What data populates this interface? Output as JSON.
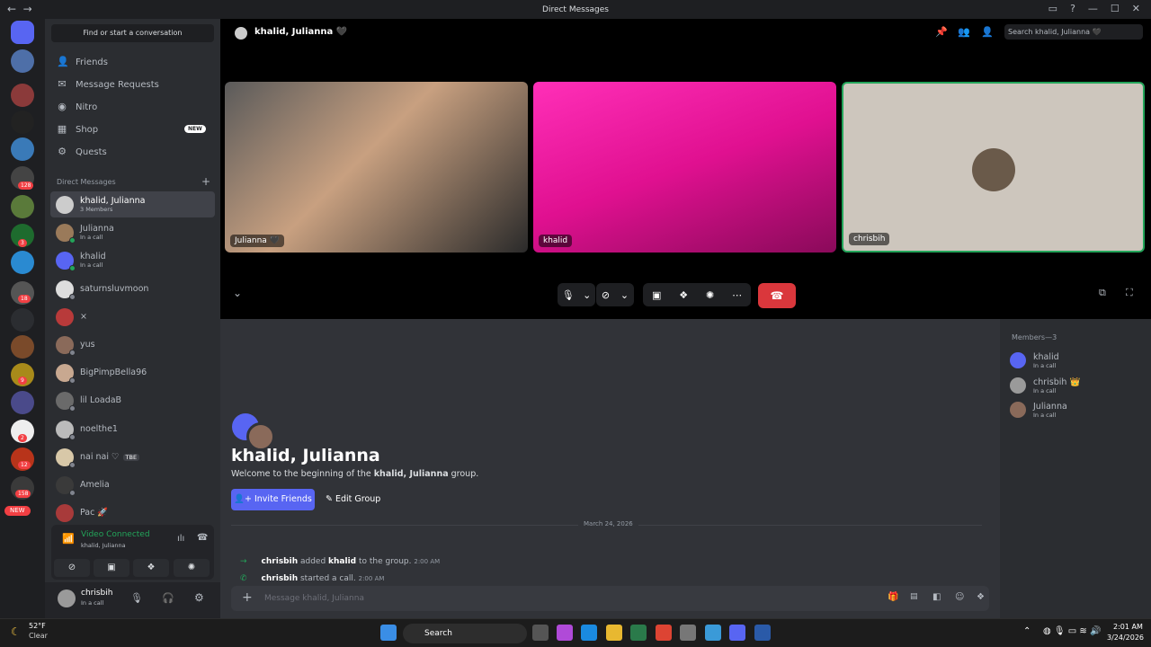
{
  "window": {
    "title": "Direct Messages"
  },
  "sidebar": {
    "find_placeholder": "Find or start a conversation",
    "nav": [
      "Friends",
      "Message Requests",
      "Nitro",
      "Shop",
      "Quests"
    ],
    "shop_badge": "NEW",
    "dm_header": "Direct Messages",
    "dms": [
      {
        "name": "khalid, Julianna",
        "sub": "3 Members"
      },
      {
        "name": "Julianna",
        "sub": "In a call"
      },
      {
        "name": "khalid",
        "sub": "In a call"
      },
      {
        "name": "saturnsluvmoon",
        "sub": ""
      },
      {
        "name": "×",
        "sub": ""
      },
      {
        "name": "yus",
        "sub": ""
      },
      {
        "name": "BigPimpBella96",
        "sub": ""
      },
      {
        "name": "lil LoadaB",
        "sub": ""
      },
      {
        "name": "noelthe1",
        "sub": ""
      },
      {
        "name": "nai nai ♡",
        "sub": "",
        "tag": "TBE"
      },
      {
        "name": "Amelia",
        "sub": ""
      },
      {
        "name": "Pac 🚀",
        "sub": ""
      }
    ],
    "voice": {
      "status": "Video Connected",
      "sub": "khalid, Julianna"
    },
    "user": {
      "name": "chrisbih",
      "sub": "In a call"
    }
  },
  "rail": {
    "badges": [
      "128",
      "3",
      "18",
      "9",
      "2",
      "12",
      "158"
    ],
    "new_label": "NEW"
  },
  "call": {
    "title": "khalid, Julianna 🖤",
    "search_placeholder": "Search khalid, Julianna 🖤",
    "tiles": [
      "Julianna 🖤",
      "khalid",
      "chrisbih"
    ]
  },
  "chat": {
    "group_title": "khalid, Julianna",
    "welcome_prefix": "Welcome to the beginning of the ",
    "welcome_group": "khalid, Julianna",
    "welcome_suffix": " group.",
    "invite_label": "Invite Friends",
    "edit_label": "Edit Group",
    "date": "March 24, 2026",
    "messages": [
      {
        "actor": "chrisbih",
        "text1": " added ",
        "target": "khalid",
        "text2": " to the group.",
        "time": "2:00 AM"
      },
      {
        "actor": "chrisbih",
        "text1": " started a call.",
        "target": "",
        "text2": "",
        "time": "2:00 AM"
      }
    ],
    "composer_placeholder": "Message khalid, Julianna"
  },
  "members": {
    "title": "Members—3",
    "list": [
      {
        "name": "khalid",
        "sub": "In a call"
      },
      {
        "name": "chrisbih 👑",
        "sub": "In a call"
      },
      {
        "name": "Julianna",
        "sub": "In a call"
      }
    ]
  },
  "taskbar": {
    "temp": "52°F",
    "condition": "Clear",
    "search": "Search",
    "time": "2:01 AM",
    "date": "3/24/2026"
  }
}
